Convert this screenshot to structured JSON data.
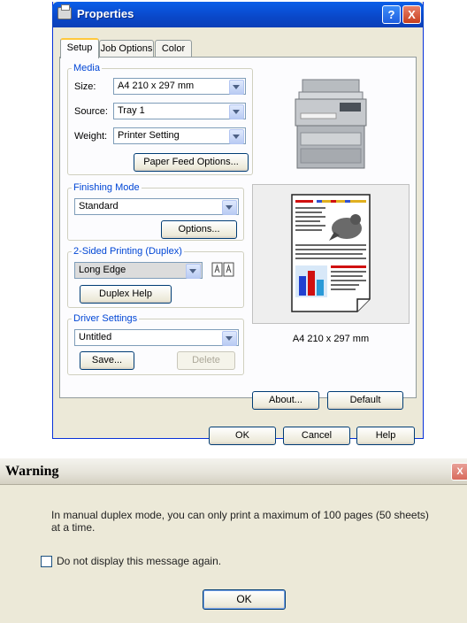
{
  "properties_window": {
    "title": "Properties",
    "help_button": "?",
    "close_button": "X",
    "tabs": [
      {
        "label": "Setup",
        "active": true
      },
      {
        "label": "Job Options",
        "active": false
      },
      {
        "label": "Color",
        "active": false
      }
    ],
    "media": {
      "legend": "Media",
      "size_label": "Size:",
      "size_value": "A4 210 x 297 mm",
      "source_label": "Source:",
      "source_value": "Tray 1",
      "weight_label": "Weight:",
      "weight_value": "Printer Setting",
      "paper_feed_button": "Paper Feed Options..."
    },
    "finishing": {
      "legend": "Finishing Mode",
      "value": "Standard",
      "options_button": "Options..."
    },
    "duplex": {
      "legend": "2-Sided Printing (Duplex)",
      "value": "Long Edge",
      "help_button": "Duplex Help"
    },
    "driver": {
      "legend": "Driver Settings",
      "value": "Untitled",
      "save_button": "Save...",
      "delete_button": "Delete"
    },
    "preview_caption": "A4 210 x 297 mm",
    "about_button": "About...",
    "default_button": "Default",
    "ok_button": "OK",
    "cancel_button": "Cancel",
    "help_footer_button": "Help"
  },
  "warning_window": {
    "title": "Warning",
    "close_button": "X",
    "message_line1": "In manual duplex mode, you can only print a maximum of 100 pages (50 sheets)",
    "message_line2": "at a time.",
    "checkbox_label": "Do not display this message again.",
    "checkbox_checked": false,
    "ok_button": "OK"
  },
  "colors": {
    "titlebar_blue": "#0a4fd4",
    "dialog_face": "#ece9d8",
    "group_legend_blue": "#0046d5"
  }
}
